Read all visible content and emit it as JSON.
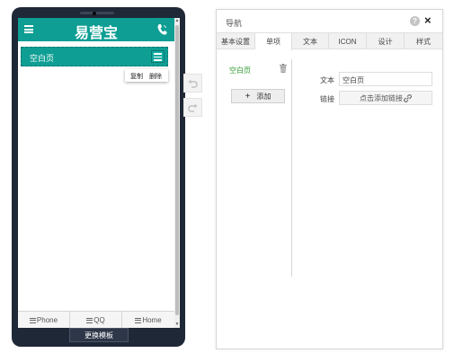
{
  "phone": {
    "app_title": "易营宝",
    "nav_item_label": "空白页",
    "context_menu": {
      "copy": "复制",
      "delete": "删除"
    },
    "bottom_tabs": [
      {
        "label": "Phone",
        "icon": "menu-lines-icon"
      },
      {
        "label": "QQ",
        "icon": "menu-lines-icon"
      },
      {
        "label": "Home",
        "icon": "menu-lines-icon"
      }
    ],
    "template_button": "更换模板"
  },
  "toolbar": {
    "undo_icon": "undo-icon",
    "redo_icon": "redo-icon"
  },
  "panel": {
    "title": "导航",
    "help_icon": "?",
    "close_icon": "×",
    "tabs": [
      {
        "label": "基本设置",
        "active": false
      },
      {
        "label": "单项",
        "active": true
      },
      {
        "label": "文本",
        "active": false
      },
      {
        "label": "ICON",
        "active": false
      },
      {
        "label": "设计",
        "active": false
      },
      {
        "label": "样式",
        "active": false
      }
    ],
    "item_list": [
      {
        "label": "空白页"
      }
    ],
    "add_button": "添加",
    "add_button_icon": "+",
    "form": {
      "text_label": "文本",
      "text_value": "空白页",
      "link_label": "链接",
      "link_button": "点击添加链接"
    }
  },
  "colors": {
    "accent": "#0e9e94",
    "phone_body": "#1f2836",
    "active_item_text": "#2f9a2f"
  }
}
